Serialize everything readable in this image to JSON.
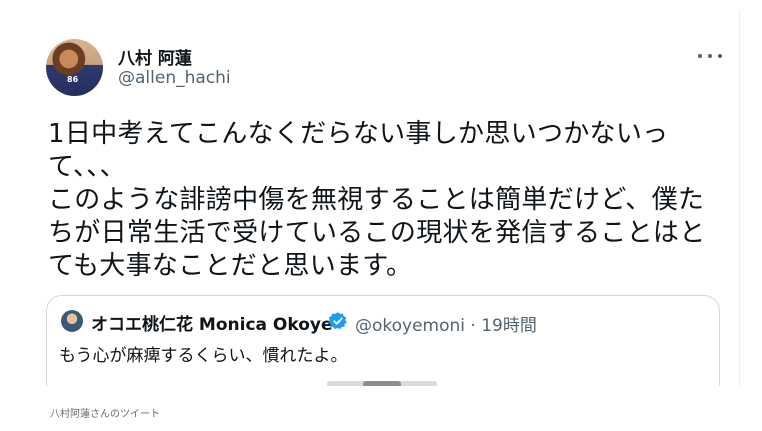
{
  "tweet": {
    "display_name": "八村 阿蓮",
    "handle": "@allen_hachi",
    "avatar_jersey": "86",
    "text": "1日中考えてこんなくだらない事しか思いつかないって、、、\nこのような誹謗中傷を無視することは簡単だけど、僕たちが日常生活で受けているこの現状を発信することはとても大事なことだと思います。",
    "more_icon": "more-horizontal-icon"
  },
  "quoted_tweet": {
    "display_name": "オコエ桃仁花 Monica Okoye",
    "handle_and_time": "@okoyemoni · 19時間",
    "text": "もう心が麻痺するくらい、慣れたよ。",
    "verified_icon": "verified-badge-icon",
    "verified_color": "#1d9bf0"
  },
  "caption": "八村阿蓮さんのツイート"
}
